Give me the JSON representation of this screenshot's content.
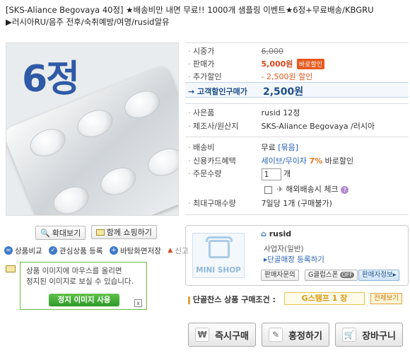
{
  "title": {
    "line1": "[SKS-Aliance Begovaya 40정] ★배송비만 내면 무료!! 1000개 샘플링 이벤트★6정+무료배송/KBGRU",
    "line2": "▶러시아RU/음주 전후/숙취예방/여명/rusid알유"
  },
  "image": {
    "badge_text": "6정"
  },
  "image_buttons": {
    "zoom": "확대보기",
    "share": "함께 쇼핑하기"
  },
  "links": {
    "compare": "상품비교",
    "wishlist": "관심상품 등록",
    "desktop": "바탕화면저장",
    "report": "신고"
  },
  "tooltip": {
    "line1": "상품 이미지에 마우스를 올리면",
    "line2": "정지된 이미지로 보실 수 있습니다.",
    "button": "정지 이미지 사용",
    "close": "x"
  },
  "price": {
    "market_label": "시중가",
    "market_value": "6,000",
    "sale_label": "판매가",
    "sale_value": "5,000원",
    "coupon_badge": "바로할인",
    "extra_label": "추가할인",
    "extra_value": "- 2,500원 할인",
    "final_label": "고객할인구매가",
    "final_value": "2,500원"
  },
  "info": {
    "gift_label": "사은품",
    "gift_value": "rusid 12정",
    "maker_label": "제조사/원산지",
    "maker_value": "SKS-Aliance Begovaya /러시아"
  },
  "order": {
    "shipping_label": "배송비",
    "shipping_value": "무료",
    "shipping_bundle": "[묶음]",
    "card_label": "신용카드혜택",
    "card_value": "세이브/무이자",
    "card_pct": "7%",
    "card_suffix": "바로할인",
    "qty_label": "주문수량",
    "qty_value": "1",
    "qty_unit": "개",
    "overseas": "해외배송시 체크",
    "max_label": "최대구매수량",
    "max_value": "7일당 1개 (구매불가)"
  },
  "shop": {
    "mini_label": "MINI SHOP",
    "seller_name": "rusid",
    "seller_grade": "사업자(일반)",
    "seller_link": "▸단골매장 등록하기",
    "btn_ask": "판매자문의",
    "btn_gclub": "G클럽스폰",
    "btn_gclub_tag": "OFF",
    "btn_info": "판매자정보▸"
  },
  "stamp": {
    "label": "단골찬스 상품 구매조건 :",
    "value": "G스탬프 1 장",
    "all": "전체보기"
  },
  "actions": {
    "buy": "즉시구매",
    "negotiate": "흥정하기",
    "cart": "장바구니"
  }
}
